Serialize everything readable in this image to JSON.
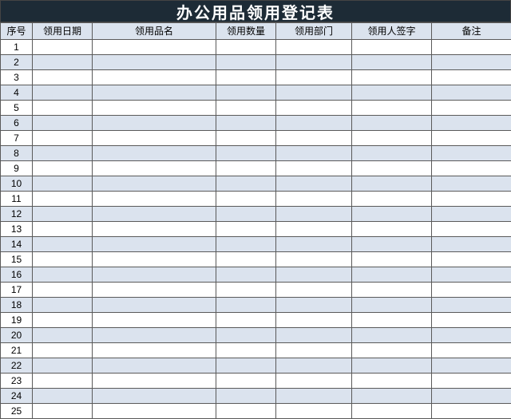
{
  "title": "办公用品领用登记表",
  "headers": {
    "seq": "序号",
    "date": "领用日期",
    "name": "领用品名",
    "qty": "领用数量",
    "dept": "领用部门",
    "sign": "领用人签字",
    "note": "备注"
  },
  "rows": [
    {
      "seq": "1",
      "date": "",
      "name": "",
      "qty": "",
      "dept": "",
      "sign": "",
      "note": ""
    },
    {
      "seq": "2",
      "date": "",
      "name": "",
      "qty": "",
      "dept": "",
      "sign": "",
      "note": ""
    },
    {
      "seq": "3",
      "date": "",
      "name": "",
      "qty": "",
      "dept": "",
      "sign": "",
      "note": ""
    },
    {
      "seq": "4",
      "date": "",
      "name": "",
      "qty": "",
      "dept": "",
      "sign": "",
      "note": ""
    },
    {
      "seq": "5",
      "date": "",
      "name": "",
      "qty": "",
      "dept": "",
      "sign": "",
      "note": ""
    },
    {
      "seq": "6",
      "date": "",
      "name": "",
      "qty": "",
      "dept": "",
      "sign": "",
      "note": ""
    },
    {
      "seq": "7",
      "date": "",
      "name": "",
      "qty": "",
      "dept": "",
      "sign": "",
      "note": ""
    },
    {
      "seq": "8",
      "date": "",
      "name": "",
      "qty": "",
      "dept": "",
      "sign": "",
      "note": ""
    },
    {
      "seq": "9",
      "date": "",
      "name": "",
      "qty": "",
      "dept": "",
      "sign": "",
      "note": ""
    },
    {
      "seq": "10",
      "date": "",
      "name": "",
      "qty": "",
      "dept": "",
      "sign": "",
      "note": ""
    },
    {
      "seq": "11",
      "date": "",
      "name": "",
      "qty": "",
      "dept": "",
      "sign": "",
      "note": ""
    },
    {
      "seq": "12",
      "date": "",
      "name": "",
      "qty": "",
      "dept": "",
      "sign": "",
      "note": ""
    },
    {
      "seq": "13",
      "date": "",
      "name": "",
      "qty": "",
      "dept": "",
      "sign": "",
      "note": ""
    },
    {
      "seq": "14",
      "date": "",
      "name": "",
      "qty": "",
      "dept": "",
      "sign": "",
      "note": ""
    },
    {
      "seq": "15",
      "date": "",
      "name": "",
      "qty": "",
      "dept": "",
      "sign": "",
      "note": ""
    },
    {
      "seq": "16",
      "date": "",
      "name": "",
      "qty": "",
      "dept": "",
      "sign": "",
      "note": ""
    },
    {
      "seq": "17",
      "date": "",
      "name": "",
      "qty": "",
      "dept": "",
      "sign": "",
      "note": ""
    },
    {
      "seq": "18",
      "date": "",
      "name": "",
      "qty": "",
      "dept": "",
      "sign": "",
      "note": ""
    },
    {
      "seq": "19",
      "date": "",
      "name": "",
      "qty": "",
      "dept": "",
      "sign": "",
      "note": ""
    },
    {
      "seq": "20",
      "date": "",
      "name": "",
      "qty": "",
      "dept": "",
      "sign": "",
      "note": ""
    },
    {
      "seq": "21",
      "date": "",
      "name": "",
      "qty": "",
      "dept": "",
      "sign": "",
      "note": ""
    },
    {
      "seq": "22",
      "date": "",
      "name": "",
      "qty": "",
      "dept": "",
      "sign": "",
      "note": ""
    },
    {
      "seq": "23",
      "date": "",
      "name": "",
      "qty": "",
      "dept": "",
      "sign": "",
      "note": ""
    },
    {
      "seq": "24",
      "date": "",
      "name": "",
      "qty": "",
      "dept": "",
      "sign": "",
      "note": ""
    },
    {
      "seq": "25",
      "date": "",
      "name": "",
      "qty": "",
      "dept": "",
      "sign": "",
      "note": ""
    }
  ]
}
